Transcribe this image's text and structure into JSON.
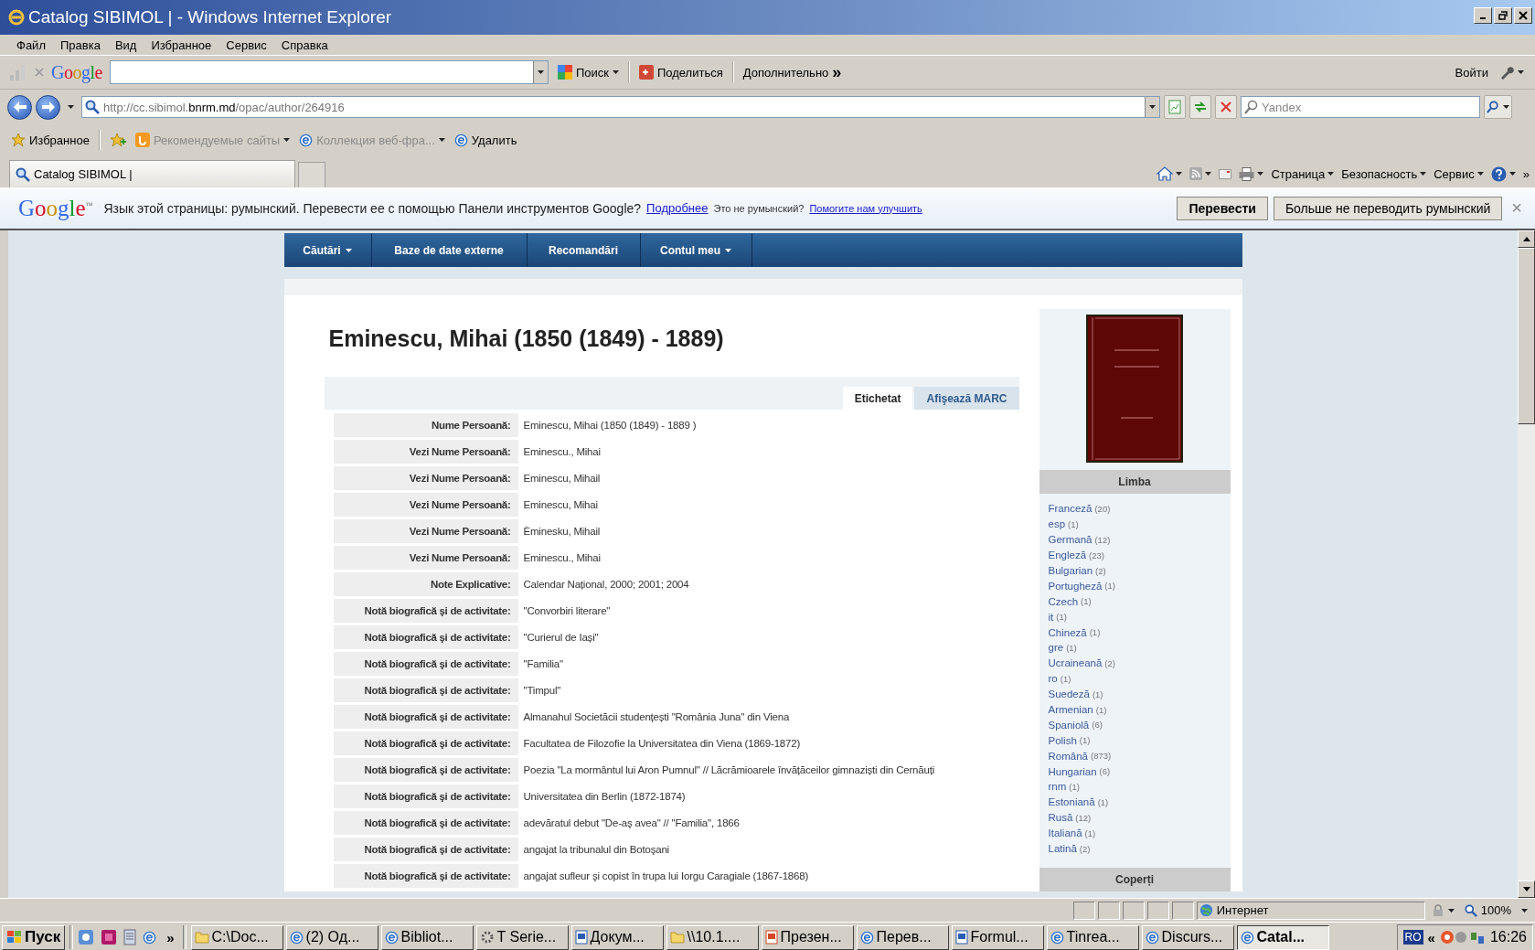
{
  "window": {
    "title": "Catalog SIBIMOL | - Windows Internet Explorer"
  },
  "menu": [
    "Файл",
    "Правка",
    "Вид",
    "Избранное",
    "Сервис",
    "Справка"
  ],
  "google_toolbar": {
    "logo": "Google",
    "search_label": "Поиск",
    "share_label": "Поделиться",
    "more_label": "Дополнительно",
    "more_glyph": "»",
    "signin_label": "Войти"
  },
  "address_bar": {
    "url_prefix": "http://cc.sibimol.",
    "url_domain": "bnrm.md",
    "url_suffix": "/opac/author/264916",
    "search_placeholder": "Yandex"
  },
  "favorites_bar": [
    {
      "label": "Избранное",
      "kind": "favorites",
      "disabled": false,
      "dropdown": false
    },
    {
      "label": "Рекомендуемые сайты",
      "kind": "suggested",
      "disabled": true,
      "dropdown": true
    },
    {
      "label": "Коллекция веб-фра...",
      "kind": "ie",
      "disabled": true,
      "dropdown": true
    },
    {
      "label": "Удалить",
      "kind": "ie",
      "disabled": false,
      "dropdown": false
    }
  ],
  "tabs": [
    {
      "label": "Catalog SIBIMOL |",
      "selected": true
    }
  ],
  "command_bar": [
    "Страница",
    "Безопасность",
    "Сервис"
  ],
  "command_overflow": "»",
  "translate_bar": {
    "logo": "Google",
    "logo_mark": "™",
    "message": "Язык этой страницы: румынский. Перевести ее с помощью Панели инструментов Google?",
    "more_link": "Подробнее",
    "question": "Это не румынский?",
    "help_link": "Помогите нам улучшить",
    "buttons": [
      "Перевести",
      "Больше не переводить румынский"
    ],
    "close": "×"
  },
  "site_nav": [
    {
      "label": "Căutări",
      "dropdown": true
    },
    {
      "label": "Baze de date externe",
      "dropdown": false
    },
    {
      "label": "Recomandări",
      "dropdown": false
    },
    {
      "label": "Contul meu",
      "dropdown": true
    }
  ],
  "record": {
    "title": "Eminescu, Mihai (1850 (1849) - 1889)",
    "view_tabs": [
      {
        "label": "Etichetat",
        "selected": true
      },
      {
        "label": "Afişează MARC",
        "selected": false
      }
    ],
    "fields": [
      {
        "label": "Nume Persoană:",
        "value": "Eminescu, Mihai (1850 (1849) - 1889 )"
      },
      {
        "label": "Vezi Nume Persoană:",
        "value": "Eminescu., Mihai"
      },
      {
        "label": "Vezi Nume Persoană:",
        "value": "Eminescu, Mihail"
      },
      {
        "label": "Vezi Nume Persoană:",
        "value": "Eminescu, Mihai"
      },
      {
        "label": "Vezi Nume Persoană:",
        "value": "Èminesku, Mihail"
      },
      {
        "label": "Vezi Nume Persoană:",
        "value": "Eminescu., Mihai"
      },
      {
        "label": "Note Explicative:",
        "value": "Calendar Național, 2000; 2001; 2004"
      },
      {
        "label": "Notă biografică şi de activitate:",
        "value": "\"Convorbiri literare\""
      },
      {
        "label": "Notă biografică şi de activitate:",
        "value": "\"Curierul de Iași\""
      },
      {
        "label": "Notă biografică şi de activitate:",
        "value": "\"Familia\""
      },
      {
        "label": "Notă biografică şi de activitate:",
        "value": "\"Timpul\""
      },
      {
        "label": "Notă biografică şi de activitate:",
        "value": "Almanahul Societăcii studențești \"România Juna\" din Viena"
      },
      {
        "label": "Notă biografică şi de activitate:",
        "value": "Facultatea de Filozofie la Universitatea din Viena (1869-1872)"
      },
      {
        "label": "Notă biografică şi de activitate:",
        "value": "Poezia \"La mormântul lui Aron Pumnul\" // Lăcrămioarele învățăceilor gimnaziști din Cernăuți"
      },
      {
        "label": "Notă biografică şi de activitate:",
        "value": "Universitatea din Berlin (1872-1874)"
      },
      {
        "label": "Notă biografică şi de activitate:",
        "value": "adevăratul debut \"De-aş avea\" // \"Familia\", 1866"
      },
      {
        "label": "Notă biografică şi de activitate:",
        "value": "angajat la tribunalul din Botoşani"
      },
      {
        "label": "Notă biografică şi de activitate:",
        "value": "angajat sufleur şi copist în trupa lui Iorgu Caragiale (1867-1868)"
      }
    ]
  },
  "sidebar": {
    "facet_title": "Limba",
    "languages": [
      {
        "name": "Franceză",
        "count": "(20)"
      },
      {
        "name": "esp",
        "count": "(1)"
      },
      {
        "name": "Germană",
        "count": "(12)"
      },
      {
        "name": "Engleză",
        "count": "(23)"
      },
      {
        "name": "Bulgarian",
        "count": "(2)"
      },
      {
        "name": "Portugheză",
        "count": "(1)"
      },
      {
        "name": "Czech",
        "count": "(1)"
      },
      {
        "name": "it",
        "count": "(1)"
      },
      {
        "name": "Chineză",
        "count": "(1)"
      },
      {
        "name": "gre",
        "count": "(1)"
      },
      {
        "name": "Ucraineană",
        "count": "(2)"
      },
      {
        "name": "ro",
        "count": "(1)"
      },
      {
        "name": "Suedeză",
        "count": "(1)"
      },
      {
        "name": "Armenian",
        "count": "(1)"
      },
      {
        "name": "Spaniolă",
        "count": "(6)"
      },
      {
        "name": "Polish",
        "count": "(1)"
      },
      {
        "name": "Română",
        "count": "(873)"
      },
      {
        "name": "Hungarian",
        "count": "(6)"
      },
      {
        "name": "rnm",
        "count": "(1)"
      },
      {
        "name": "Estoniană",
        "count": "(1)"
      },
      {
        "name": "Rusă",
        "count": "(12)"
      },
      {
        "name": "Italiană",
        "count": "(1)"
      },
      {
        "name": "Latină",
        "count": "(2)"
      }
    ],
    "next_facet": "Coperți"
  },
  "status_bar": {
    "zone": "Интернет",
    "zoom": "100%"
  },
  "taskbar": {
    "start": "Пуск",
    "overflow": "»",
    "tasks": [
      {
        "label": "C:\\Doc...",
        "kind": "folder",
        "selected": false
      },
      {
        "label": "(2) Од...",
        "kind": "ie",
        "selected": false
      },
      {
        "label": "Bibliot...",
        "kind": "ie",
        "selected": false
      },
      {
        "label": "T Serie...",
        "kind": "app",
        "selected": false
      },
      {
        "label": "Докум...",
        "kind": "word",
        "selected": false
      },
      {
        "label": "\\\\10.1....",
        "kind": "folder",
        "selected": false
      },
      {
        "label": "Презен...",
        "kind": "ppt",
        "selected": false
      },
      {
        "label": "Перев...",
        "kind": "ie",
        "selected": false
      },
      {
        "label": "Formul...",
        "kind": "word",
        "selected": false
      },
      {
        "label": "Tinrea...",
        "kind": "ie",
        "selected": false
      },
      {
        "label": "Discurs...",
        "kind": "ie",
        "selected": false
      },
      {
        "label": "Catal...",
        "kind": "ie",
        "selected": true
      }
    ],
    "lang": "RO",
    "expand": "«",
    "clock": "16:26"
  }
}
